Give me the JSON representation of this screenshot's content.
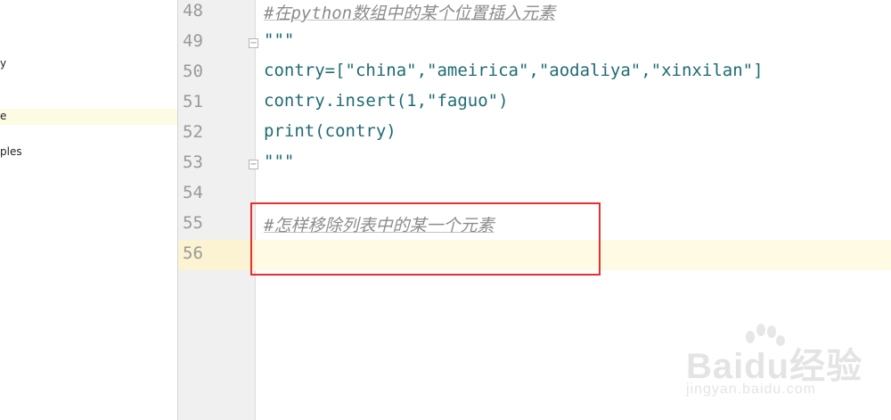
{
  "sidebar": {
    "items": [
      {
        "label": "y"
      },
      {
        "label": "e"
      },
      {
        "label": "ples"
      }
    ]
  },
  "editor": {
    "lines": [
      {
        "number": "48",
        "text": "#在python数组中的某个位置插入元素"
      },
      {
        "number": "49",
        "text": "\"\"\""
      },
      {
        "number": "50",
        "text": "contry=[\"china\",\"ameirica\",\"aodaliya\",\"xinxilan\"]"
      },
      {
        "number": "51",
        "text": "contry.insert(1,\"faguo\")"
      },
      {
        "number": "52",
        "text": "print(contry)"
      },
      {
        "number": "53",
        "text": "\"\"\""
      },
      {
        "number": "54",
        "text": ""
      },
      {
        "number": "55",
        "text": "#怎样移除列表中的某一个元素"
      },
      {
        "number": "56",
        "text": ""
      }
    ]
  },
  "watermark": {
    "brand": "Baidu经验",
    "url": "jingyan.baidu.com"
  },
  "colors": {
    "accent_box": "#e53030",
    "current_line": "#fffae3"
  }
}
